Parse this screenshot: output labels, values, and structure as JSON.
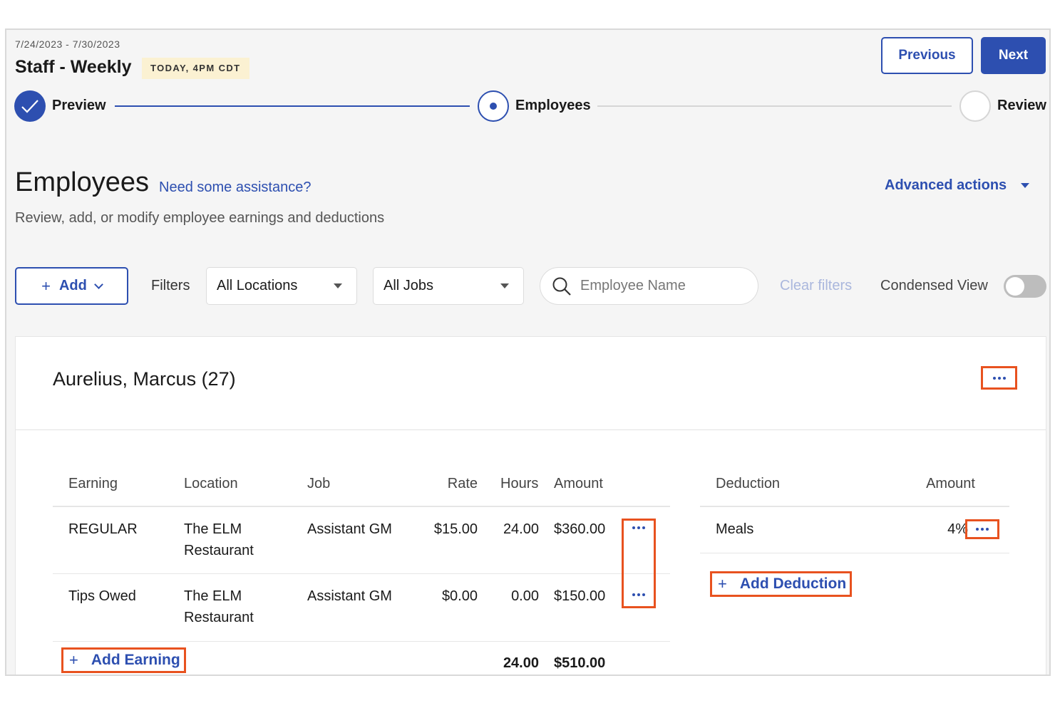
{
  "header": {
    "date_range": "7/24/2023 - 7/30/2023",
    "title": "Staff - Weekly",
    "deadline": "TODAY, 4PM CDT",
    "previous_label": "Previous",
    "next_label": "Next"
  },
  "stepper": {
    "steps": [
      {
        "label": "Preview",
        "state": "complete"
      },
      {
        "label": "Employees",
        "state": "current"
      },
      {
        "label": "Review",
        "state": "upcoming"
      }
    ]
  },
  "page": {
    "title": "Employees",
    "help_link": "Need some assistance?",
    "subtitle": "Review, add, or modify employee earnings and deductions",
    "advanced_actions": "Advanced actions"
  },
  "toolbar": {
    "add_label": "Add",
    "filters_label": "Filters",
    "locations_value": "All Locations",
    "jobs_value": "All Jobs",
    "search_placeholder": "Employee Name",
    "clear_filters": "Clear filters",
    "condensed_label": "Condensed View",
    "condensed_on": false
  },
  "employee": {
    "name": "Aurelius, Marcus (27)",
    "earnings": {
      "headers": {
        "earning": "Earning",
        "location": "Location",
        "job": "Job",
        "rate": "Rate",
        "hours": "Hours",
        "amount": "Amount"
      },
      "rows": [
        {
          "earning": "REGULAR",
          "location_line1": "The ELM",
          "location_line2": "Restaurant",
          "job": "Assistant GM",
          "rate": "$15.00",
          "hours": "24.00",
          "amount": "$360.00"
        },
        {
          "earning": "Tips Owed",
          "location_line1": "The ELM",
          "location_line2": "Restaurant",
          "job": "Assistant GM",
          "rate": "$0.00",
          "hours": "0.00",
          "amount": "$150.00"
        }
      ],
      "add_label": "Add Earning",
      "total_hours": "24.00",
      "total_amount": "$510.00"
    },
    "deductions": {
      "headers": {
        "deduction": "Deduction",
        "amount": "Amount"
      },
      "rows": [
        {
          "deduction": "Meals",
          "amount": "4%"
        }
      ],
      "add_label": "Add Deduction"
    }
  },
  "colors": {
    "accent": "#2d4fb0",
    "highlight": "#e8521f",
    "badge_bg": "#fbf1d2",
    "background": "#f5f5f5"
  }
}
